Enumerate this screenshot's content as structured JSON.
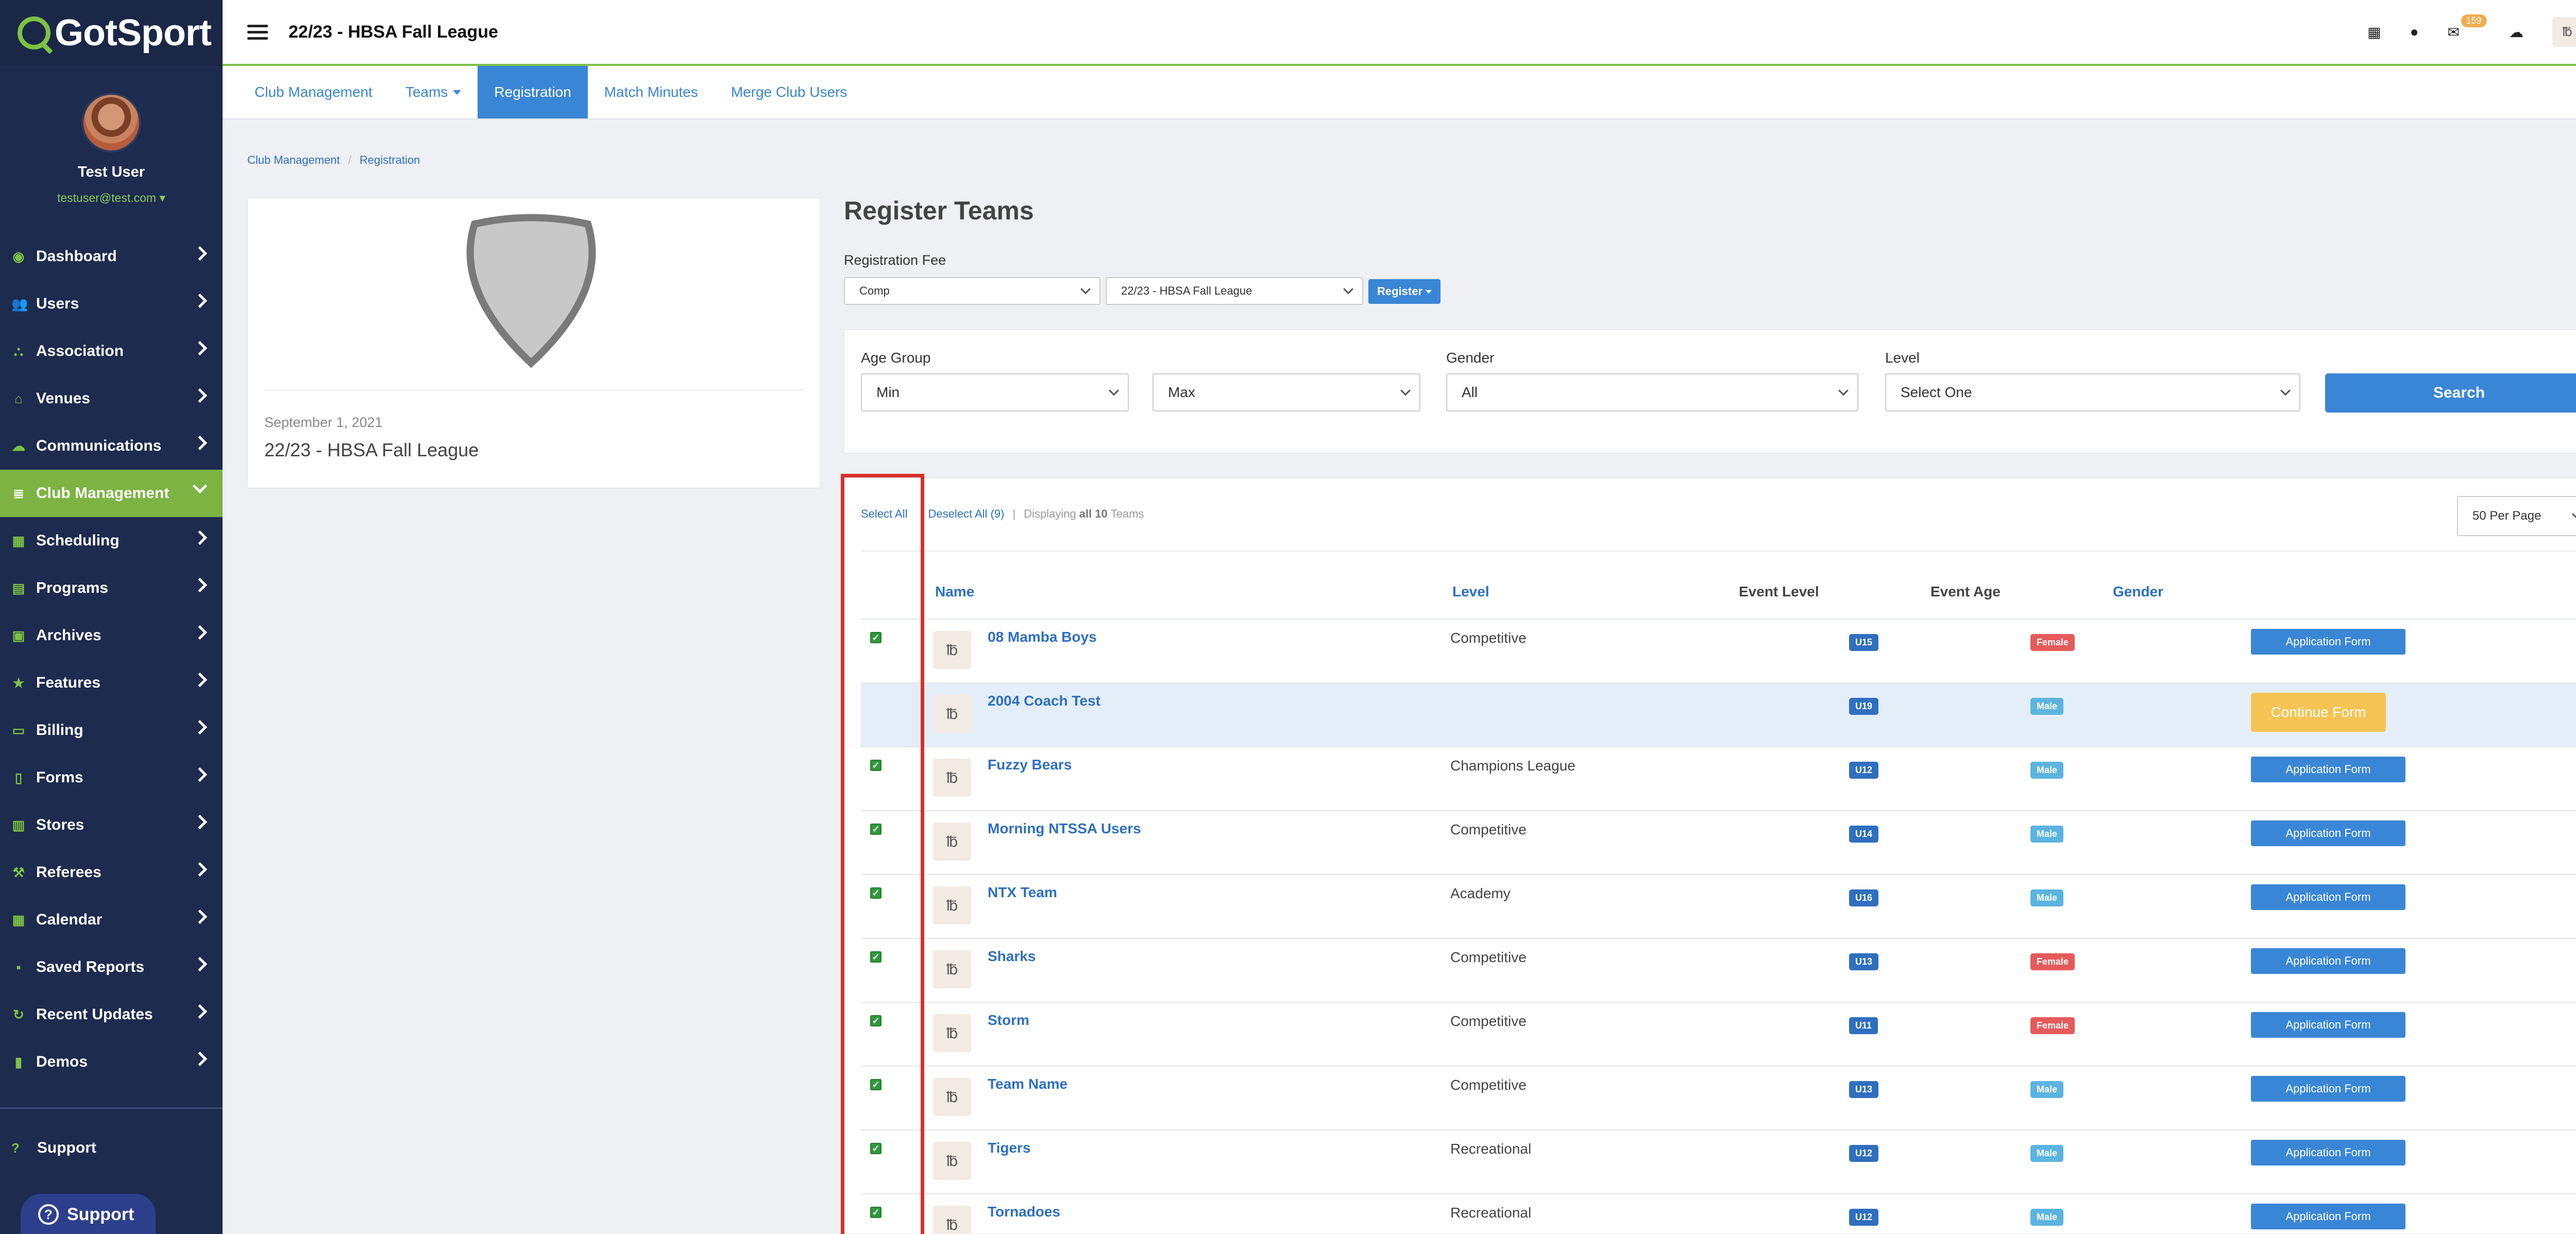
{
  "sidebar": {
    "logo": "GotSport",
    "user_name": "Test User",
    "user_email": "testuser@test.com ▾",
    "items": [
      {
        "label": "Dashboard",
        "icon": "dashboard-icon",
        "glyph": "◉"
      },
      {
        "label": "Users",
        "icon": "users-icon",
        "glyph": "👥"
      },
      {
        "label": "Association",
        "icon": "association-icon",
        "glyph": "⛬"
      },
      {
        "label": "Venues",
        "icon": "home-icon",
        "glyph": "⌂"
      },
      {
        "label": "Communications",
        "icon": "chat-icon",
        "glyph": "☁"
      },
      {
        "label": "Club Management",
        "icon": "list-icon",
        "glyph": "≣"
      },
      {
        "label": "Scheduling",
        "icon": "calendar-grid-icon",
        "glyph": "▦"
      },
      {
        "label": "Programs",
        "icon": "book-icon",
        "glyph": "▤"
      },
      {
        "label": "Archives",
        "icon": "archive-icon",
        "glyph": "▣"
      },
      {
        "label": "Features",
        "icon": "star-icon",
        "glyph": "★"
      },
      {
        "label": "Billing",
        "icon": "credit-card-icon",
        "glyph": "▭"
      },
      {
        "label": "Forms",
        "icon": "file-icon",
        "glyph": "▯"
      },
      {
        "label": "Stores",
        "icon": "store-icon",
        "glyph": "▥"
      },
      {
        "label": "Referees",
        "icon": "whistle-icon",
        "glyph": "⚒"
      },
      {
        "label": "Calendar",
        "icon": "calendar-icon",
        "glyph": "▦"
      },
      {
        "label": "Saved Reports",
        "icon": "save-icon",
        "glyph": "▪"
      },
      {
        "label": "Recent Updates",
        "icon": "refresh-icon",
        "glyph": "↻"
      },
      {
        "label": "Demos",
        "icon": "document-icon",
        "glyph": "▮"
      }
    ],
    "support_label": "Support",
    "support_button": "Support"
  },
  "topbar": {
    "title": "22/23 - HBSA Fall League",
    "mail_count": "159"
  },
  "tabs": [
    {
      "label": "Club Management",
      "active": false
    },
    {
      "label": "Teams",
      "active": false,
      "dropdown": true
    },
    {
      "label": "Registration",
      "active": true
    },
    {
      "label": "Match Minutes",
      "active": false
    },
    {
      "label": "Merge Club Users",
      "active": false
    }
  ],
  "breadcrumb": [
    "Club Management",
    "Registration"
  ],
  "event": {
    "date": "September 1, 2021",
    "name": "22/23 - HBSA Fall League"
  },
  "register": {
    "title": "Register Teams",
    "fee_label": "Registration Fee",
    "fee_value": "Comp",
    "event_value": "22/23 - HBSA Fall League",
    "register_button": "Register"
  },
  "filters": {
    "age_group_label": "Age Group",
    "min_value": "Min",
    "max_value": "Max",
    "gender_label": "Gender",
    "gender_value": "All",
    "level_label": "Level",
    "level_value": "Select One",
    "search_button": "Search"
  },
  "results": {
    "select_all": "Select All",
    "deselect_all": "Deselect All (9)",
    "displaying_prefix": "Displaying",
    "displaying_all": "all 10",
    "displaying_suffix": "Teams",
    "per_page": "50 Per Page",
    "columns": {
      "name": "Name",
      "level": "Level",
      "event_level": "Event Level",
      "event_age": "Event Age",
      "gender": "Gender"
    },
    "rows": [
      {
        "name": "08 Mamba Boys",
        "level": "Competitive",
        "age": "U15",
        "gender": "Female",
        "checked": true,
        "action": "Application Form"
      },
      {
        "name": "2004 Coach Test",
        "level": "",
        "age": "U19",
        "gender": "Male",
        "checked": false,
        "action": "Continue Form"
      },
      {
        "name": "Fuzzy Bears",
        "level": "Champions League",
        "age": "U12",
        "gender": "Male",
        "checked": true,
        "action": "Application Form"
      },
      {
        "name": "Morning NTSSA Users",
        "level": "Competitive",
        "age": "U14",
        "gender": "Male",
        "checked": true,
        "action": "Application Form"
      },
      {
        "name": "NTX Team",
        "level": "Academy",
        "age": "U16",
        "gender": "Male",
        "checked": true,
        "action": "Application Form"
      },
      {
        "name": "Sharks",
        "level": "Competitive",
        "age": "U13",
        "gender": "Female",
        "checked": true,
        "action": "Application Form"
      },
      {
        "name": "Storm",
        "level": "Competitive",
        "age": "U11",
        "gender": "Female",
        "checked": true,
        "action": "Application Form"
      },
      {
        "name": "Team Name",
        "level": "Competitive",
        "age": "U13",
        "gender": "Male",
        "checked": true,
        "action": "Application Form"
      },
      {
        "name": "Tigers",
        "level": "Recreational",
        "age": "U12",
        "gender": "Male",
        "checked": true,
        "action": "Application Form"
      },
      {
        "name": "Tornadoes",
        "level": "Recreational",
        "age": "U12",
        "gender": "Male",
        "checked": true,
        "action": "Application Form"
      }
    ]
  },
  "team_icon_glyph": "℔",
  "colors": {
    "accent": "#3a86d6",
    "brand_green": "#7cc243",
    "sidebar_bg": "#1d2b4f",
    "female": "#e65a5a",
    "male": "#5bb4e0",
    "continue": "#f6c454",
    "highlight": "#d8302a"
  }
}
